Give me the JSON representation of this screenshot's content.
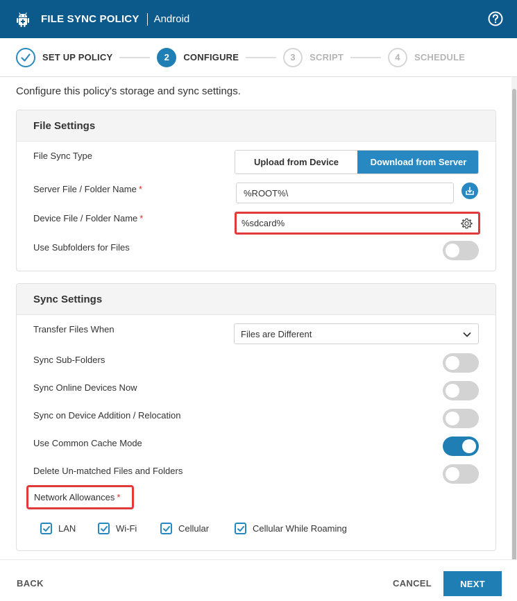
{
  "header": {
    "logo_icon": "android-robot-icon",
    "title": "FILE SYNC POLICY",
    "platform": "Android",
    "help_icon": "help-circle-icon"
  },
  "stepper": {
    "steps": [
      {
        "num": "",
        "label": "SET UP POLICY",
        "state": "done",
        "icon": "check-circle-icon"
      },
      {
        "num": "2",
        "label": "CONFIGURE",
        "state": "active"
      },
      {
        "num": "3",
        "label": "SCRIPT",
        "state": "todo"
      },
      {
        "num": "4",
        "label": "SCHEDULE",
        "state": "todo"
      }
    ]
  },
  "intro": "Configure this policy's storage and sync settings.",
  "file_settings": {
    "title": "File Settings",
    "sync_type_label": "File Sync Type",
    "sync_type_options": [
      "Upload from Device",
      "Download from Server"
    ],
    "sync_type_selected": "Download from Server",
    "server_label": "Server File / Folder Name",
    "server_value": "%ROOT%\\",
    "device_label": "Device File / Folder Name",
    "device_value": "%sdcard%",
    "subfolders_label": "Use Subfolders for Files",
    "subfolders_on": false,
    "required_mark": "*"
  },
  "sync_settings": {
    "title": "Sync Settings",
    "transfer_label": "Transfer Files When",
    "transfer_value": "Files are Different",
    "toggles": [
      {
        "label": "Sync Sub-Folders",
        "on": false
      },
      {
        "label": "Sync Online Devices Now",
        "on": false
      },
      {
        "label": "Sync on Device Addition / Relocation",
        "on": false
      },
      {
        "label": "Use Common Cache Mode",
        "on": true
      },
      {
        "label": "Delete Un-matched Files and Folders",
        "on": false
      }
    ],
    "network_label": "Network Allowances",
    "network_options": [
      {
        "label": "LAN",
        "checked": true
      },
      {
        "label": "Wi-Fi",
        "checked": true
      },
      {
        "label": "Cellular",
        "checked": true
      },
      {
        "label": "Cellular While Roaming",
        "checked": true
      }
    ]
  },
  "footer": {
    "back": "BACK",
    "cancel": "CANCEL",
    "next": "NEXT"
  },
  "colors": {
    "header_bg": "#0c5a8c",
    "accent": "#1f7fb5",
    "highlight": "#e03a3a"
  }
}
